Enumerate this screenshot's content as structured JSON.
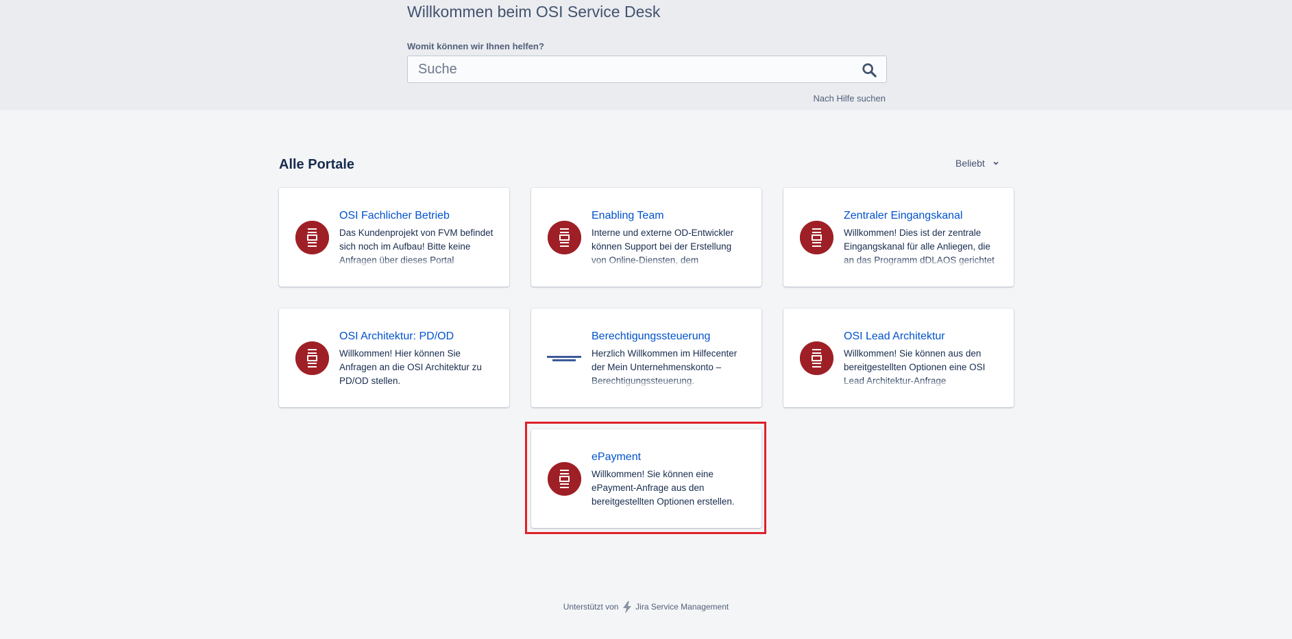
{
  "banner": {
    "title": "Willkommen beim OSI Service Desk",
    "search_label": "Womit können wir Ihnen helfen?",
    "search_placeholder": "Suche",
    "search_value": "",
    "search_help": "Nach Hilfe suchen"
  },
  "portals": {
    "section_title": "Alle Portale",
    "sort_label": "Beliebt",
    "items": [
      {
        "title": "OSI Fachlicher Betrieb",
        "description": "Das Kundenprojekt von FVM befindet sich noch im Aufbau! Bitte keine Anfragen über dieses Portal",
        "logo": "osi-logo"
      },
      {
        "title": "Enabling Team",
        "description": "Interne und externe OD-Entwickler können Support bei der Erstellung von Online-Diensten, dem",
        "logo": "osi-logo"
      },
      {
        "title": "Zentraler Eingangskanal",
        "description": "Willkommen! Dies ist der zentrale Eingangskanal für alle Anliegen, die an das Programm dDLAOS gerichtet",
        "logo": "osi-logo"
      },
      {
        "title": "OSI Architektur: PD/OD",
        "description": "Willkommen! Hier können Sie Anfragen an die OSI Architektur zu PD/OD stellen.",
        "logo": "osi-logo"
      },
      {
        "title": "Berechtigungssteuerung",
        "description": "Herzlich Willkommen im Hilfecenter der Mein Unternehmenskonto – Berechtigungssteuerung.",
        "logo": "unternehmenskonto-logo"
      },
      {
        "title": "OSI Lead Architektur",
        "description": "Willkommen! Sie können aus den bereitgestellten Optionen eine OSI Lead Architektur-Anfrage",
        "logo": "osi-logo"
      },
      {
        "title": "ePayment",
        "description": "Willkommen! Sie können eine ePayment-Anfrage aus den bereitgestellten Optionen erstellen.",
        "logo": "osi-logo"
      }
    ]
  },
  "footer": {
    "prefix": "Unterstützt von",
    "product": "Jira Service Management"
  },
  "colors": {
    "logo_red": "#9e2026",
    "link_blue": "#0052cc",
    "highlight_red": "#e0202a"
  }
}
